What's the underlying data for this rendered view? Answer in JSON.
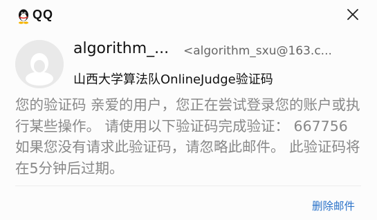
{
  "app": {
    "name": "QQ"
  },
  "email": {
    "sender_name": "algorithm_...",
    "sender_email": "<algorithm_sxu@163.c...",
    "subject": "山西大学算法队OnlineJudge验证码",
    "body": "您的验证码 亲爱的用户，您正在尝试登录您的账户或执行某些操作。 请使用以下验证码完成验证： 667756 如果您没有请求此验证码，请忽略此邮件。 此验证码将在5分钟后过期。"
  },
  "actions": {
    "delete_label": "删除邮件"
  },
  "colors": {
    "accent": "#2a72c9",
    "body_text": "#888888",
    "avatar_bg": "#e9e9e9"
  }
}
